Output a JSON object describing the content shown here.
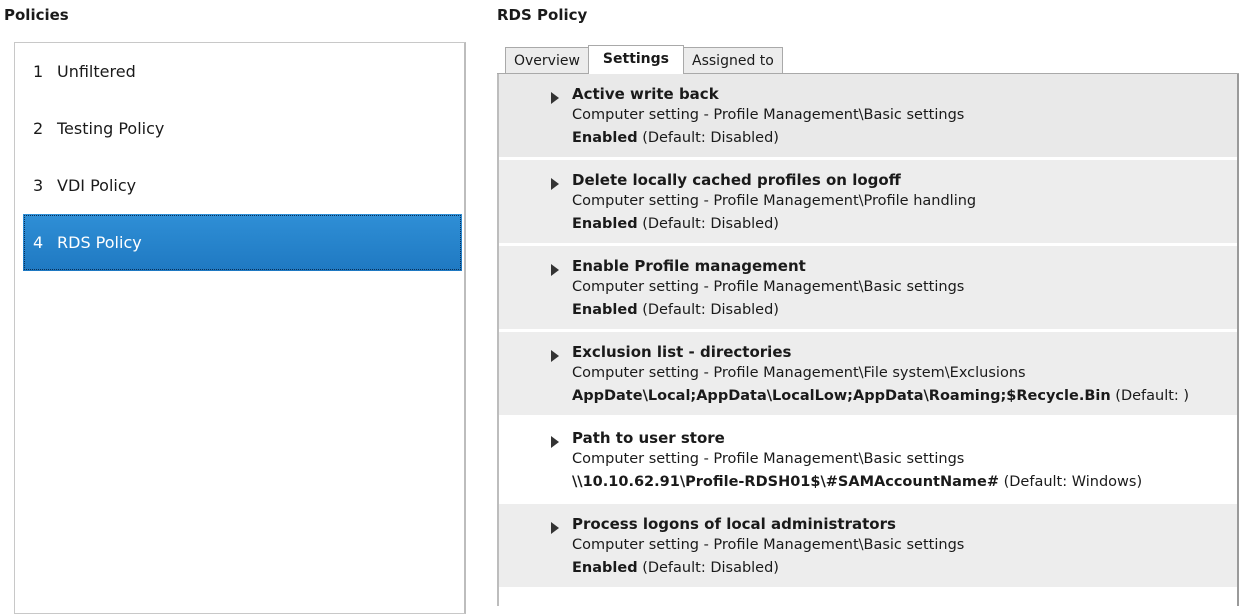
{
  "left": {
    "title": "Policies",
    "policies": [
      {
        "number": "1",
        "name": "Unfiltered"
      },
      {
        "number": "2",
        "name": "Testing Policy"
      },
      {
        "number": "3",
        "name": "VDI Policy"
      },
      {
        "number": "4",
        "name": "RDS Policy"
      }
    ],
    "selected_index": 3
  },
  "right": {
    "title": "RDS Policy",
    "tabs": [
      "Overview",
      "Settings",
      "Assigned to"
    ],
    "active_tab": "Settings",
    "settings": [
      {
        "name": "Active write back",
        "path": "Computer setting - Profile Management\\Basic settings",
        "value": "Enabled",
        "default": "(Default: Disabled)"
      },
      {
        "name": "Delete locally cached profiles on logoff",
        "path": "Computer setting - Profile Management\\Profile handling",
        "value": "Enabled",
        "default": "(Default: Disabled)"
      },
      {
        "name": "Enable Profile management",
        "path": "Computer setting - Profile Management\\Basic settings",
        "value": "Enabled",
        "default": "(Default: Disabled)"
      },
      {
        "name": "Exclusion list - directories",
        "path": "Computer setting - Profile Management\\File system\\Exclusions",
        "value": "AppDate\\Local;AppData\\LocalLow;AppData\\Roaming;$Recycle.Bin",
        "default": "(Default: )"
      },
      {
        "name": "Path to user store",
        "path": "Computer setting - Profile Management\\Basic settings",
        "value": "\\\\10.10.62.91\\Profile-RDSH01$\\#SAMAccountName#",
        "default": "(Default: Windows)"
      },
      {
        "name": "Process logons of local administrators",
        "path": "Computer setting - Profile Management\\Basic settings",
        "value": "Enabled",
        "default": "(Default: Disabled)"
      }
    ]
  },
  "colors": {
    "selection": "#1f79c2",
    "row_shade": "#ededed"
  },
  "icons": {
    "expand": "triangle-right-icon"
  }
}
